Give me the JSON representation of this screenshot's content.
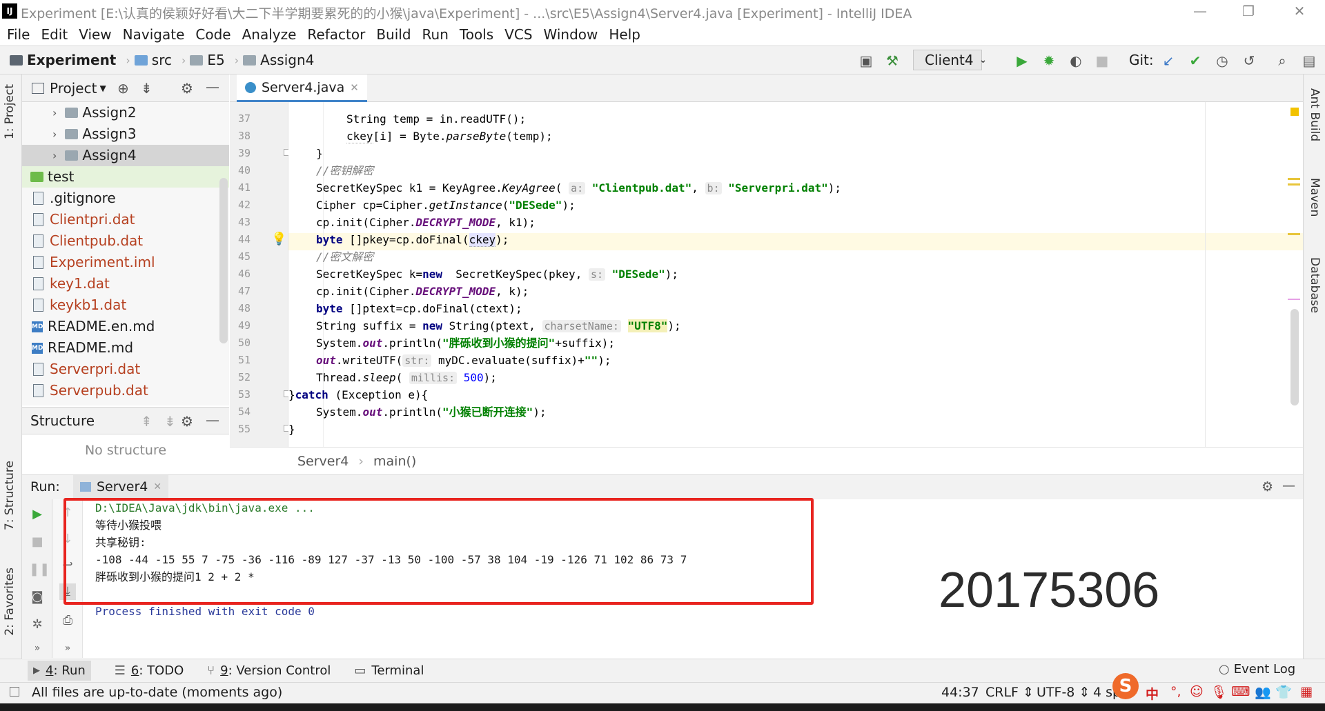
{
  "window": {
    "title": "Experiment [E:\\认真的侯颖好好看\\大二下半学期要累死的的小猴\\java\\Experiment] - ...\\src\\E5\\Assign4\\Server4.java [Experiment] - IntelliJ IDEA",
    "logo": "IJ"
  },
  "menu": [
    "File",
    "Edit",
    "View",
    "Navigate",
    "Code",
    "Analyze",
    "Refactor",
    "Build",
    "Run",
    "Tools",
    "VCS",
    "Window",
    "Help"
  ],
  "nav": {
    "breadcrumbs": [
      "Experiment",
      "src",
      "E5",
      "Assign4"
    ],
    "run_config": "Client4",
    "git_label": "Git:"
  },
  "left_stripe": {
    "project": "1: Project",
    "structure": "7: Structure",
    "favorites": "2: Favorites"
  },
  "right_stripe": {
    "ant": "Ant Build",
    "maven": "Maven",
    "database": "Database"
  },
  "project_panel": {
    "title": "Project",
    "items": [
      {
        "label": "Assign2",
        "type": "folder"
      },
      {
        "label": "Assign3",
        "type": "folder"
      },
      {
        "label": "Assign4",
        "type": "folder"
      },
      {
        "label": "test",
        "type": "folder"
      },
      {
        "label": ".gitignore",
        "type": "file"
      },
      {
        "label": "Clientpri.dat",
        "type": "file"
      },
      {
        "label": "Clientpub.dat",
        "type": "file"
      },
      {
        "label": "Experiment.iml",
        "type": "file"
      },
      {
        "label": "key1.dat",
        "type": "file"
      },
      {
        "label": "keykb1.dat",
        "type": "file"
      },
      {
        "label": "README.en.md",
        "type": "md"
      },
      {
        "label": "README.md",
        "type": "md"
      },
      {
        "label": "Serverpri.dat",
        "type": "file"
      },
      {
        "label": "Serverpub.dat",
        "type": "file"
      }
    ]
  },
  "structure_panel": {
    "title": "Structure",
    "empty": "No structure"
  },
  "editor": {
    "tab": "Server4.java",
    "line_numbers": [
      "37",
      "38",
      "39",
      "40",
      "41",
      "42",
      "43",
      "44",
      "45",
      "46",
      "47",
      "48",
      "49",
      "50",
      "51",
      "52",
      "53",
      "54",
      "55"
    ],
    "breadcrumb": [
      "Server4",
      "main()"
    ],
    "tokens": {
      "l37": "String temp = in.readUTF();",
      "l38a": "ckey",
      "l38b": "[i] = Byte.",
      "l38c": "parseByte",
      "l38d": "(temp);",
      "l39": "}",
      "l40": "//密钥解密",
      "l41a": "SecretKeySpec k1 = KeyAgree.",
      "l41b": "KeyAgree",
      "l41c": "(",
      "l41h1": "a:",
      "l41s1": "\"Clientpub.dat\"",
      "l41d": ",",
      "l41h2": "b:",
      "l41s2": "\"Serverpri.dat\"",
      "l41e": ");",
      "l42a": "Cipher cp=Cipher.",
      "l42b": "getInstance",
      "l42c": "(",
      "l42s": "\"DESede\"",
      "l42d": ");",
      "l43a": "cp.init(Cipher.",
      "l43b": "DECRYPT_MODE",
      "l43c": ", k1);",
      "l44a": "byte",
      "l44b": " []pkey=cp.doFinal(",
      "l44c": "ckey",
      "l44d": ");",
      "l45": "//密文解密",
      "l46a": "SecretKeySpec k=",
      "l46b": "new",
      "l46c": "  SecretKeySpec(pkey, ",
      "l46h": "s:",
      "l46s": "\"DESede\"",
      "l46d": ");",
      "l47a": "cp.init(Cipher.",
      "l47b": "DECRYPT_MODE",
      "l47c": ", k);",
      "l48a": "byte",
      "l48b": " []ptext=cp.doFinal(ctext);",
      "l49a": "String suffix = ",
      "l49b": "new",
      "l49c": " String(ptext, ",
      "l49h": "charsetName:",
      "l49s": "\"UTF8\"",
      "l49d": ");",
      "l50a": "System.",
      "l50b": "out",
      "l50c": ".println(",
      "l50s": "\"胖砾收到小猴的提问\"",
      "l50d": "+suffix);",
      "l51a": "out",
      "l51b": ".writeUTF(",
      "l51h": "str:",
      "l51c": " myDC.evaluate(suffix)+",
      "l51s": "\"\"",
      "l51d": ");",
      "l52a": "Thread.",
      "l52b": "sleep",
      "l52c": "(",
      "l52h": "millis:",
      "l52n": "500",
      "l52d": ");",
      "l53a": "}",
      "l53b": "catch",
      "l53c": " (Exception e){",
      "l54a": "System.",
      "l54b": "out",
      "l54c": ".println(",
      "l54s": "\"小猴已断开连接\"",
      "l54d": ");",
      "l55": "}"
    }
  },
  "run": {
    "label": "Run:",
    "tab": "Server4",
    "lines": [
      "D:\\IDEA\\Java\\jdk\\bin\\java.exe ...",
      "等待小猴投喂",
      "共享秘钥:",
      "-108 -44 -15 55 7 -75 -36 -116 -89 127 -37 -13 50 -100 -57 38 104 -19 -126 71 102 86 73 7",
      "胖砾收到小猴的提问1 2 + 2 *",
      "",
      "Process finished with exit code 0"
    ],
    "watermark": "20175306"
  },
  "tool_windows": [
    {
      "num": "4",
      "rest": ": Run"
    },
    {
      "num": "6",
      "rest": ": TODO"
    },
    {
      "num": "9",
      "rest": ": Version Control"
    },
    {
      "num": "",
      "rest": "Terminal"
    }
  ],
  "event_log": "Event Log",
  "status": {
    "message": "All files are up-to-date (moments ago)",
    "position": "44:37",
    "line_sep": "CRLF ⇕",
    "encoding": "UTF-8 ⇕",
    "indent": "4 sp",
    "ime": "中"
  },
  "colors": {
    "accent": "#4083c9",
    "highlight_box": "#e8241f",
    "keyword": "#000080",
    "string": "#008000"
  }
}
